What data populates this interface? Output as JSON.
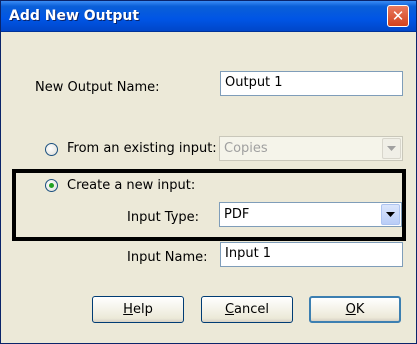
{
  "window": {
    "title": "Add New Output",
    "close_glyph": "✕"
  },
  "form": {
    "output_name_label": "New Output Name:",
    "output_name_value": "Output 1",
    "existing_input_label": "From an existing input:",
    "existing_input_value": "Copies",
    "existing_input_selected": false,
    "new_input_label": "Create a new input:",
    "new_input_selected": true,
    "input_type_label": "Input Type:",
    "input_type_value": "PDF",
    "input_name_label": "Input Name:",
    "input_name_value": "Input 1"
  },
  "buttons": {
    "help_mnemonic": "H",
    "help_rest": "elp",
    "cancel_mnemonic": "C",
    "cancel_rest": "ancel",
    "ok_mnemonic": "O",
    "ok_rest": "K"
  },
  "colors": {
    "title_bar": "#0055e5",
    "dialog_bg": "#ece9d8",
    "highlight_border": "#000000"
  },
  "icons": {
    "close": "close-icon",
    "dropdown": "chevron-down-icon",
    "radio_selected": "radio-selected-icon"
  }
}
